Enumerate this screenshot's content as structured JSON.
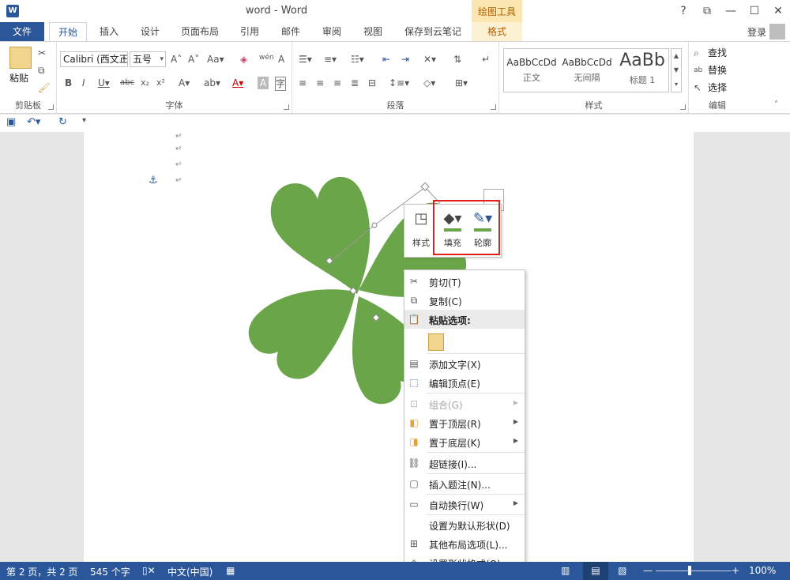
{
  "titlebar": {
    "title": "word - Word",
    "contextual_tab_title": "绘图工具",
    "window_buttons": [
      "?",
      "⧉",
      "—",
      "☐",
      "✕"
    ]
  },
  "tabs": [
    "文件",
    "开始",
    "插入",
    "设计",
    "页面布局",
    "引用",
    "邮件",
    "审阅",
    "视图",
    "保存到云笔记",
    "格式"
  ],
  "account": {
    "login_label": "登录"
  },
  "ribbon": {
    "clipboard": {
      "label": "剪贴板",
      "paste_label": "粘贴"
    },
    "font": {
      "label": "字体",
      "font_name": "Calibri (西文正",
      "font_size": "五号"
    },
    "paragraph": {
      "label": "段落"
    },
    "styles": {
      "label": "样式",
      "items": [
        {
          "sample": "AaBbCcDd",
          "name": "正文"
        },
        {
          "sample": "AaBbCcDd",
          "name": "无间隔"
        },
        {
          "sample": "AaBb",
          "name": "标题 1"
        }
      ]
    },
    "editing": {
      "label": "编辑",
      "find": "查找",
      "replace": "替换",
      "select": "选择"
    }
  },
  "mini_toolbar": {
    "style": "样式",
    "fill": "填充",
    "outline": "轮廓"
  },
  "context_menu": {
    "cut": "剪切(T)",
    "copy": "复制(C)",
    "paste_options": "粘贴选项:",
    "add_text": "添加文字(X)",
    "edit_points": "编辑顶点(E)",
    "group": "组合(G)",
    "bring_to_front": "置于顶层(R)",
    "send_to_back": "置于底层(K)",
    "hyperlink": "超链接(I)...",
    "insert_caption": "插入题注(N)...",
    "wrap_text": "自动换行(W)",
    "set_default_shape": "设置为默认形状(D)",
    "more_layout": "其他布局选项(L)...",
    "format_shape": "设置形状格式(O)..."
  },
  "statusbar": {
    "page": "第 2 页，共 2 页",
    "words": "545 个字",
    "language": "中文(中国)",
    "zoom": "100%"
  },
  "colors": {
    "accent": "#2b579a",
    "shape_fill": "#6ba54a",
    "highlight_box": "#e0201b"
  }
}
